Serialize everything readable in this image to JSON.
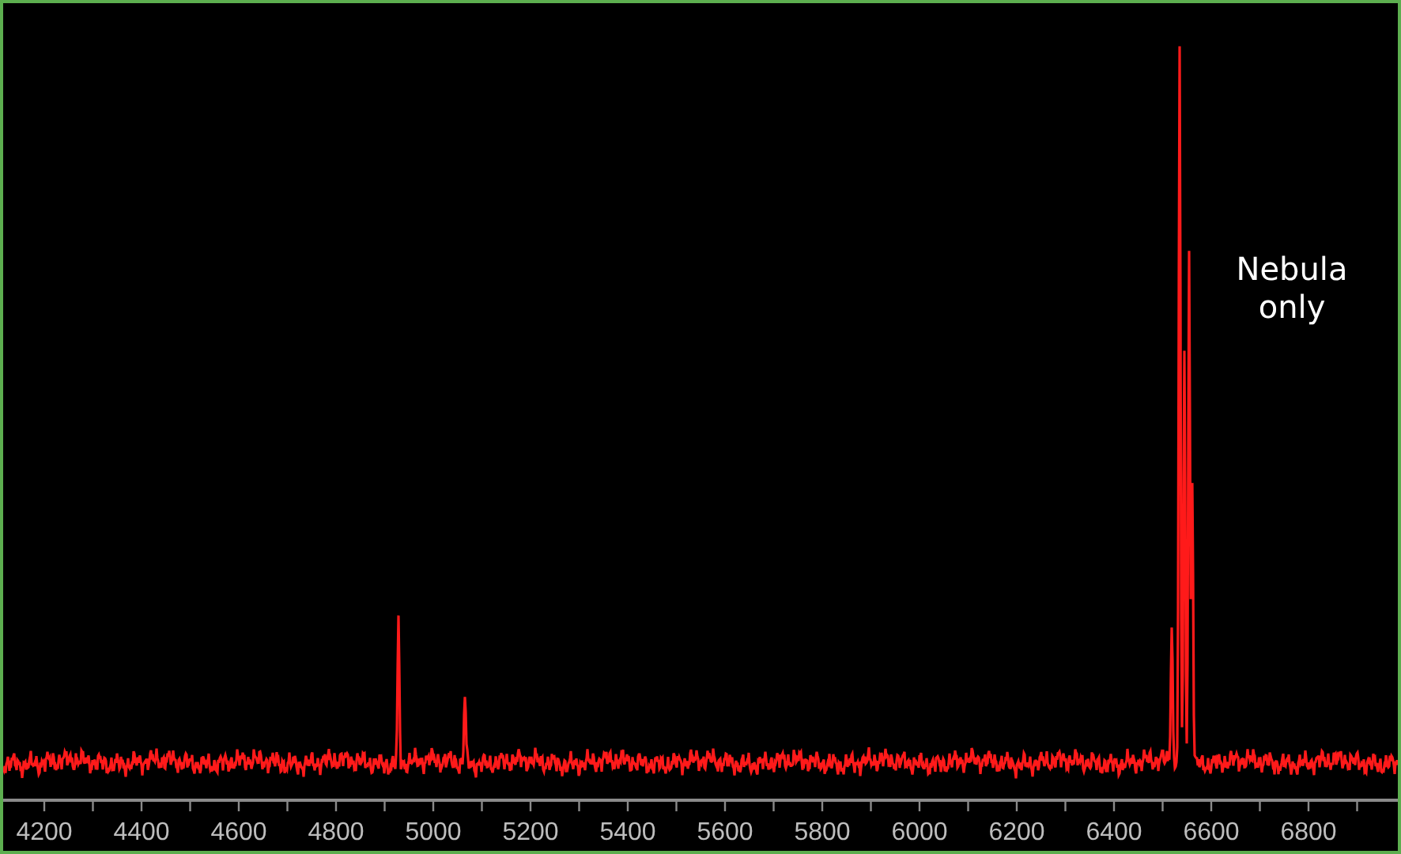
{
  "plot": {
    "annotation": "Nebula only",
    "x_tick_labels": [
      "4200",
      "4400",
      "4600",
      "4800",
      "5000",
      "5200",
      "5400",
      "5600",
      "5800",
      "6000",
      "6200",
      "6400",
      "6600",
      "6800"
    ]
  }
}
